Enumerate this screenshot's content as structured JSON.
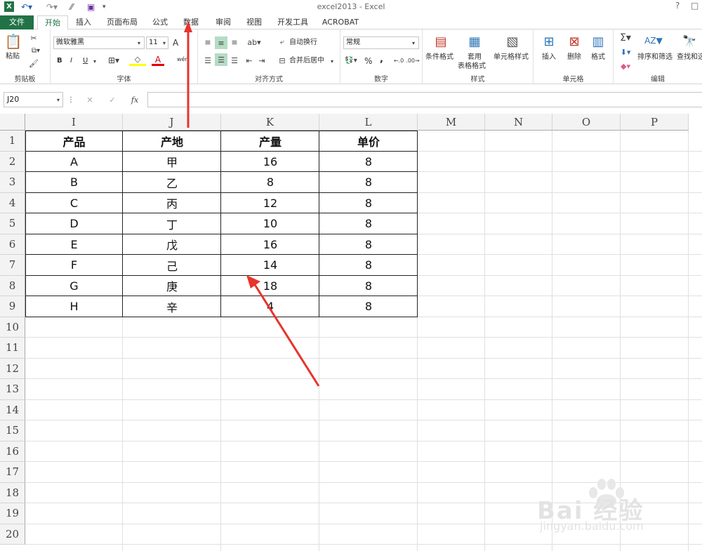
{
  "app": {
    "title": "excel2013 - Excel",
    "help": "?",
    "restore": "□"
  },
  "tabs": [
    {
      "label": "文件"
    },
    {
      "label": "开始"
    },
    {
      "label": "插入"
    },
    {
      "label": "页面布局"
    },
    {
      "label": "公式"
    },
    {
      "label": "数据"
    },
    {
      "label": "审阅"
    },
    {
      "label": "视图"
    },
    {
      "label": "开发工具"
    },
    {
      "label": "ACROBAT"
    }
  ],
  "ribbon": {
    "clipboard": {
      "label": "剪贴板",
      "paste": "粘贴"
    },
    "font": {
      "label": "字体",
      "name": "微软雅黑",
      "size": "11",
      "bold": "B",
      "italic": "I",
      "underline": "U",
      "grow": "A",
      "wen": "wén"
    },
    "alignment": {
      "label": "对齐方式",
      "wrap": "自动换行",
      "merge": "合并后居中"
    },
    "number": {
      "label": "数字",
      "format": "常规",
      "percent": "%",
      "comma": ","
    },
    "styles": {
      "label": "样式",
      "conditional": "条件格式",
      "table1": "套用",
      "table2": "表格格式",
      "cell": "单元格样式"
    },
    "cells": {
      "label": "单元格",
      "insert": "插入",
      "delete": "删除",
      "format": "格式"
    },
    "editing": {
      "label": "编辑",
      "sort": "排序和筛选",
      "find": "查找和选"
    }
  },
  "formula": {
    "namebox": "J20",
    "fx": "fx",
    "content": ""
  },
  "columns": [
    "I",
    "J",
    "K",
    "L",
    "M",
    "N",
    "O",
    "P"
  ],
  "rows": [
    "1",
    "2",
    "3",
    "4",
    "5",
    "6",
    "7",
    "8",
    "9",
    "10",
    "11",
    "12",
    "13",
    "14",
    "15",
    "16",
    "17",
    "18",
    "19",
    "20"
  ],
  "table": {
    "headers": [
      "产品",
      "产地",
      "产量",
      "单价"
    ],
    "data": [
      [
        "A",
        "甲",
        "16",
        "8"
      ],
      [
        "B",
        "乙",
        "8",
        "8"
      ],
      [
        "C",
        "丙",
        "12",
        "8"
      ],
      [
        "D",
        "丁",
        "10",
        "8"
      ],
      [
        "E",
        "戊",
        "16",
        "8"
      ],
      [
        "F",
        "己",
        "14",
        "8"
      ],
      [
        "G",
        "庚",
        "18",
        "8"
      ],
      [
        "H",
        "辛",
        "4",
        "8"
      ]
    ]
  },
  "watermark": {
    "brand": "Bai 经验",
    "url": "jingyan.baidu.com"
  },
  "colors": {
    "excel_green": "#217346",
    "arrow_red": "#e8342c"
  }
}
